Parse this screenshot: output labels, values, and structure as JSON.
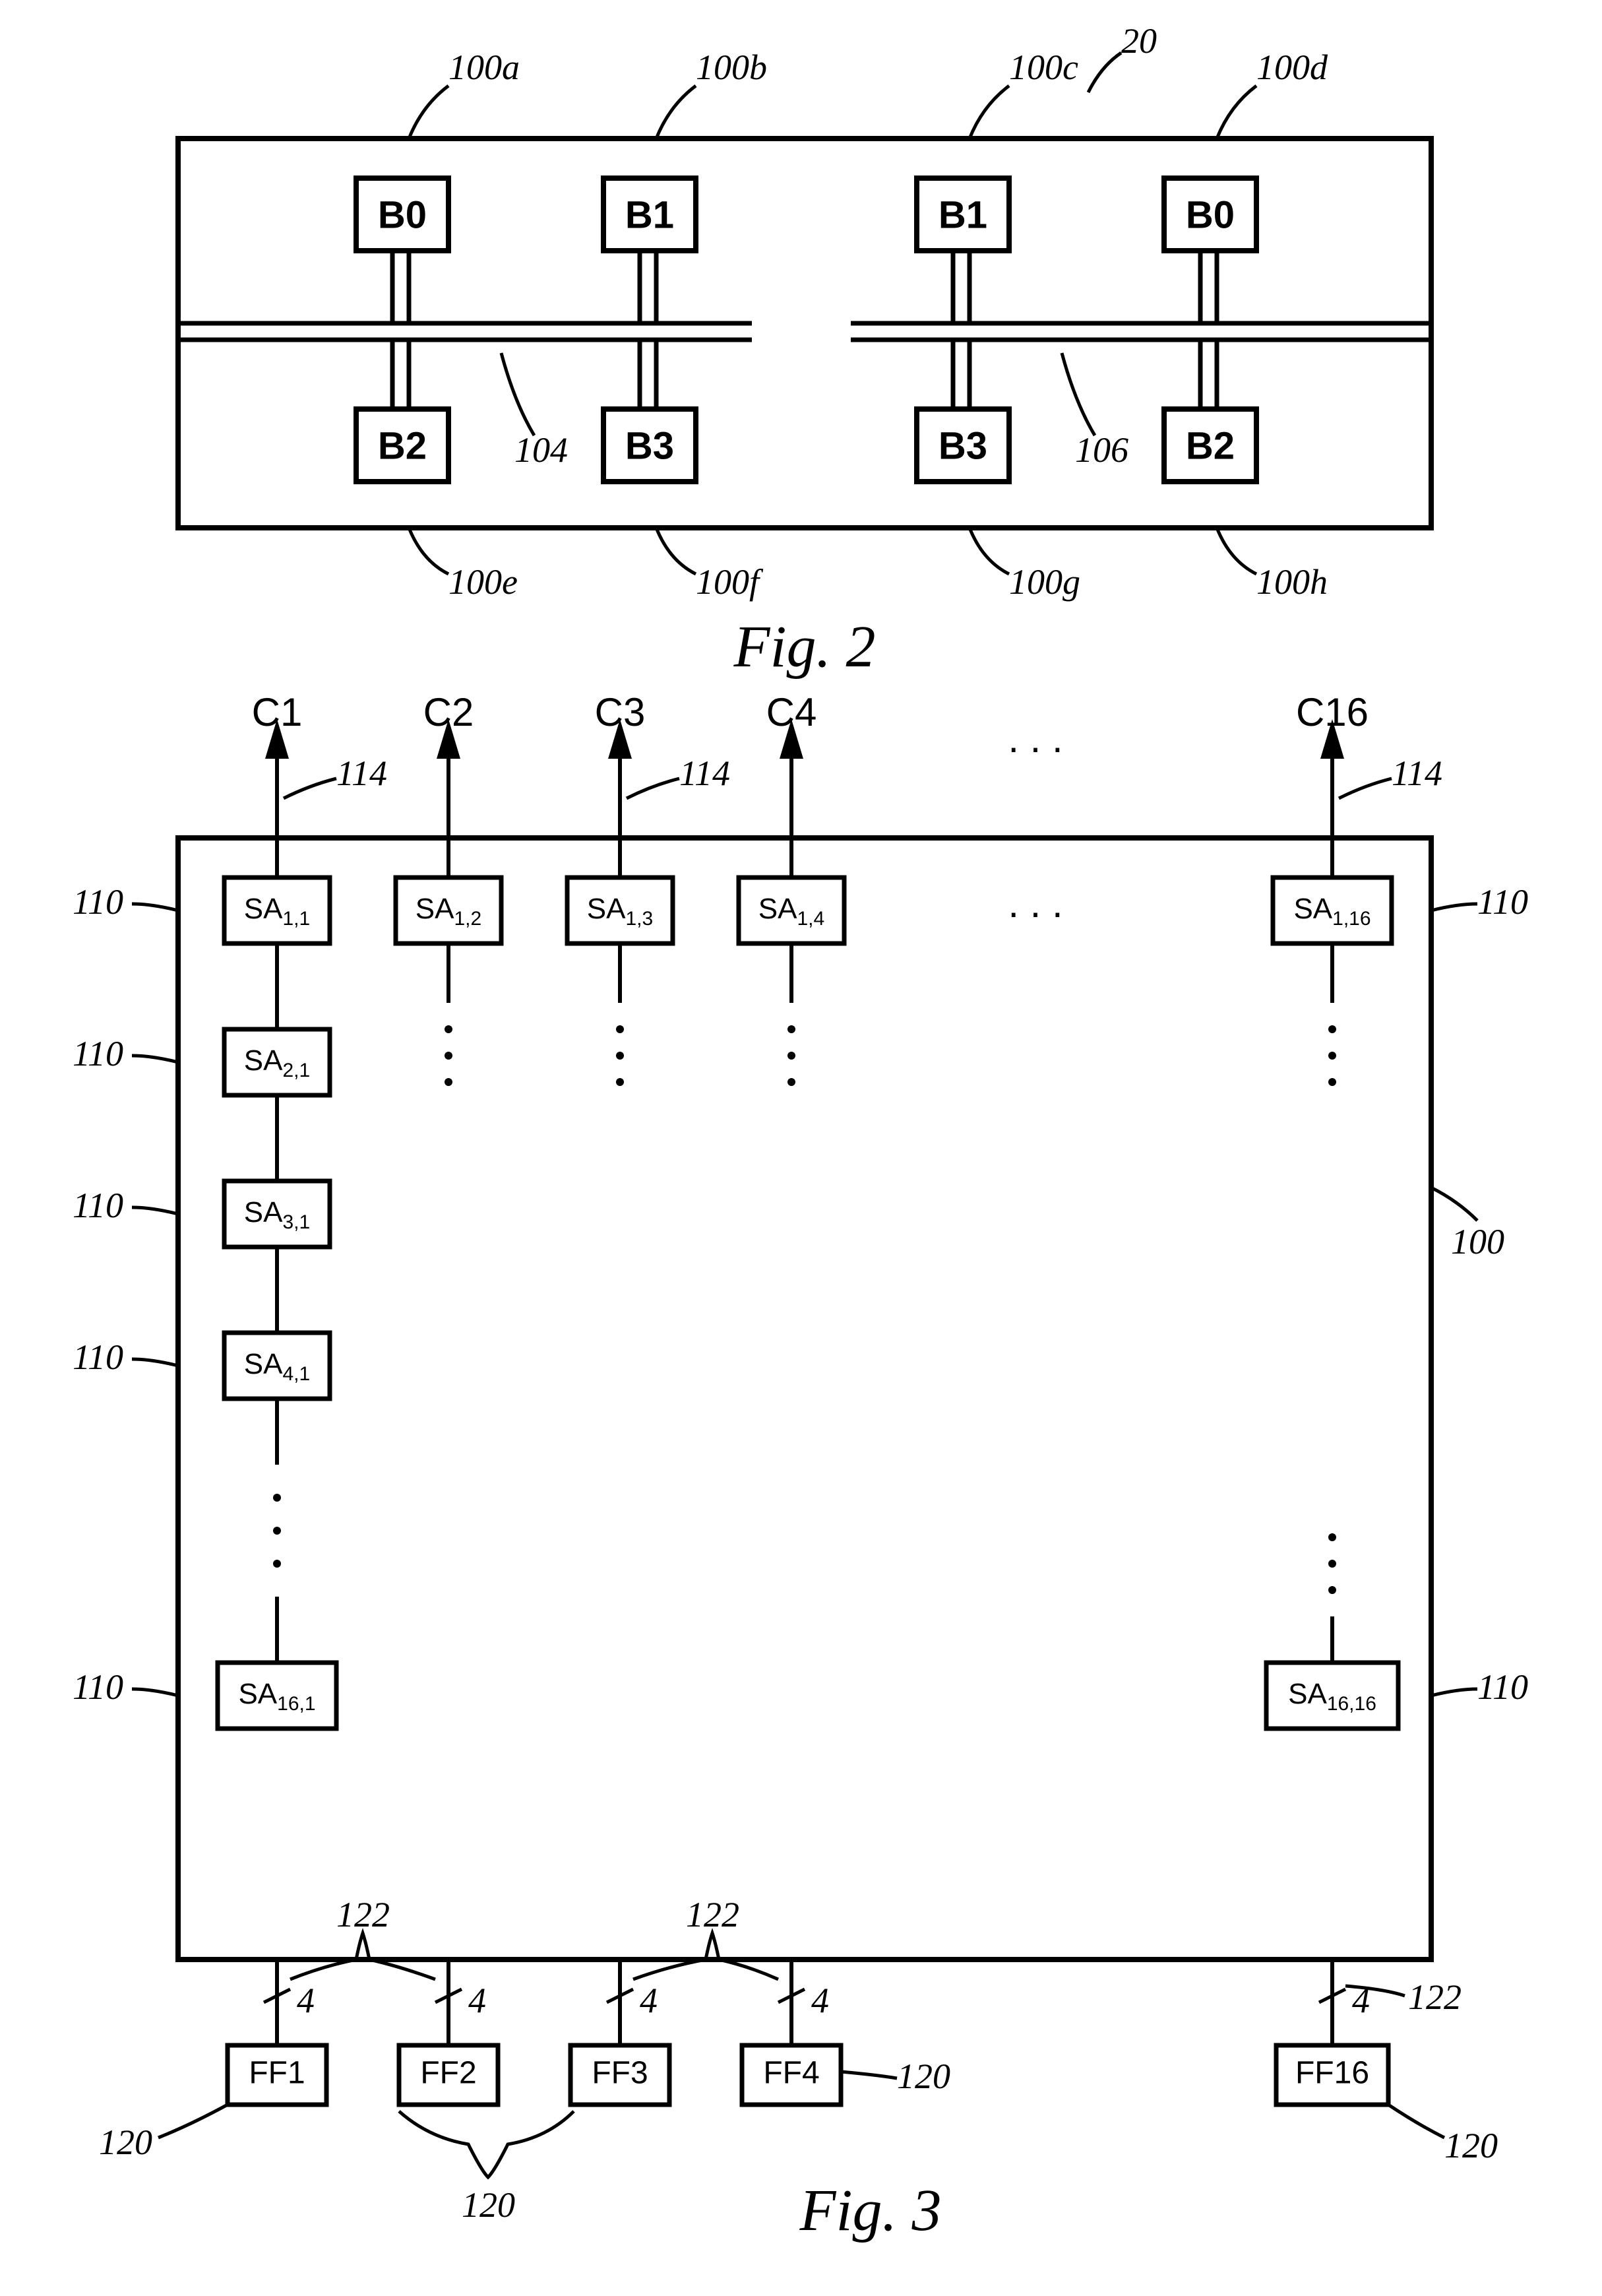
{
  "fig2": {
    "caption": "Fig. 2",
    "outerRef": "20",
    "blocks": [
      {
        "id": "100a",
        "label": "B0",
        "ref": "100a"
      },
      {
        "id": "100b",
        "label": "B1",
        "ref": "100b"
      },
      {
        "id": "100c",
        "label": "B1",
        "ref": "100c"
      },
      {
        "id": "100d",
        "label": "B0",
        "ref": "100d"
      },
      {
        "id": "100e",
        "label": "B2",
        "ref": "100e"
      },
      {
        "id": "100f",
        "label": "B3",
        "ref": "100f"
      },
      {
        "id": "100g",
        "label": "B3",
        "ref": "100g"
      },
      {
        "id": "100h",
        "label": "B2",
        "ref": "100h"
      }
    ],
    "groupRefs": {
      "left": "104",
      "right": "106"
    }
  },
  "fig3": {
    "caption": "Fig. 3",
    "outerRef": "100",
    "columns": [
      "C1",
      "C2",
      "C3",
      "C4",
      "C16"
    ],
    "colRef": "114",
    "saRef": "110",
    "ffRef": "120",
    "busRef": "122",
    "busWidth": "4",
    "saBlocks": {
      "row1": [
        "SA1,1",
        "SA1,2",
        "SA1,3",
        "SA1,4",
        "SA1,16"
      ],
      "col1": [
        "SA1,1",
        "SA2,1",
        "SA3,1",
        "SA4,1",
        "SA16,1"
      ],
      "lastCol": [
        "SA1,16",
        "SA16,16"
      ]
    },
    "ffBlocks": [
      "FF1",
      "FF2",
      "FF3",
      "FF4",
      "FF16"
    ],
    "ellipsis": ". . ."
  }
}
